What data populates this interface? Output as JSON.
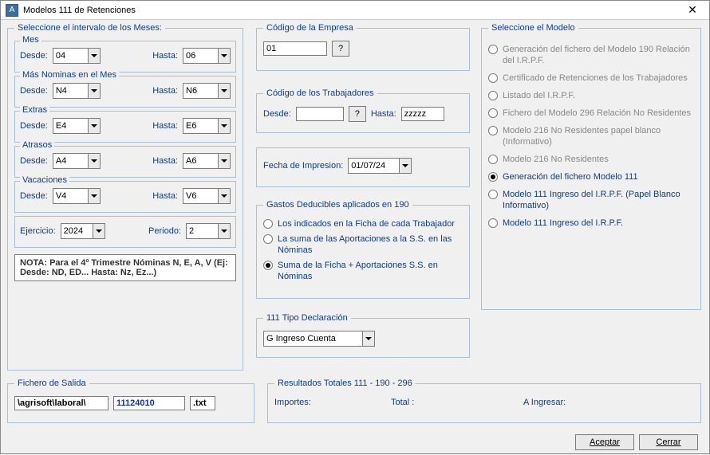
{
  "title": "Modelos 111 de Retenciones",
  "intervalos": {
    "legend": "Seleccione el intervalo de los Meses:",
    "mes": {
      "legend": "Mes",
      "desde_label": "Desde:",
      "desde": "04",
      "hasta_label": "Hasta:",
      "hasta": "06"
    },
    "masnom": {
      "legend": "Más Nominas en el Mes",
      "desde_label": "Desde:",
      "desde": "N4",
      "hasta_label": "Hasta:",
      "hasta": "N6"
    },
    "extras": {
      "legend": "Extras",
      "desde_label": "Desde:",
      "desde": "E4",
      "hasta_label": "Hasta:",
      "hasta": "E6"
    },
    "atrasos": {
      "legend": "Atrasos",
      "desde_label": "Desde:",
      "desde": "A4",
      "hasta_label": "Hasta:",
      "hasta": "A6"
    },
    "vacac": {
      "legend": "Vacaciones",
      "desde_label": "Desde:",
      "desde": "V4",
      "hasta_label": "Hasta:",
      "hasta": "V6"
    },
    "ejercicio_label": "Ejercicio:",
    "ejercicio": "2024",
    "periodo_label": "Periodo:",
    "periodo": "2",
    "nota": "NOTA: Para el 4º Trimestre Nóminas N, E, A, V   (Ej: Desde: ND, ED... Hasta: Nz, Ez...)"
  },
  "empresa": {
    "legend": "Código de la Empresa",
    "codigo": "01",
    "help": "?"
  },
  "trabajadores": {
    "legend": "Código de los Trabajadores",
    "desde_label": "Desde:",
    "desde": "",
    "help": "?",
    "hasta_label": "Hasta:",
    "hasta": "zzzzz"
  },
  "fecha": {
    "label": "Fecha de Impresion:",
    "value": "01/07/24"
  },
  "gastos": {
    "legend": "Gastos Deducibles aplicados en 190",
    "options": [
      "Los indicados en la Ficha de cada Trabajador",
      "La suma de las Aportaciones a la S.S. en las Nóminas",
      "Suma de la Ficha + Aportaciones S.S. en Nóminas"
    ],
    "selected": 2
  },
  "tipo111": {
    "legend": "111 Tipo Declaración",
    "value": "G Ingreso Cuenta"
  },
  "modelo": {
    "legend": "Seleccione el Modelo",
    "options": [
      {
        "label": "Generación del fichero del Modelo 190 Relación del  I.R.P.F.",
        "enabled": false
      },
      {
        "label": "Certificado de Retenciones de los Trabajadores",
        "enabled": false
      },
      {
        "label": "Listado del I.R.P.F.",
        "enabled": false
      },
      {
        "label": "Fichero del Modelo 296 Relación No Residentes",
        "enabled": false
      },
      {
        "label": "Modelo 216 No Residentes papel blanco (Informativo)",
        "enabled": false
      },
      {
        "label": "Modelo 216 No Residentes",
        "enabled": false
      },
      {
        "label": "Generación del fichero Modelo 111",
        "enabled": true
      },
      {
        "label": "Modelo 111 Ingreso del  I.R.P.F. (Papel Blanco Informativo)",
        "enabled": true
      },
      {
        "label": "Modelo 111 Ingreso del I.R.P.F.",
        "enabled": true
      }
    ],
    "selected": 6
  },
  "fichero": {
    "legend": "Fichero de Salida",
    "path": "\\agrisoft\\laboral\\",
    "name": "11124010",
    "ext": ".txt"
  },
  "resultados": {
    "legend": "Resultados Totales  111 - 190  -  296",
    "importes_label": "Importes:",
    "total_label": "Total :",
    "aingresar_label": "A Ingresar:"
  },
  "buttons": {
    "aceptar": "Aceptar",
    "cerrar": "Cerrar"
  }
}
